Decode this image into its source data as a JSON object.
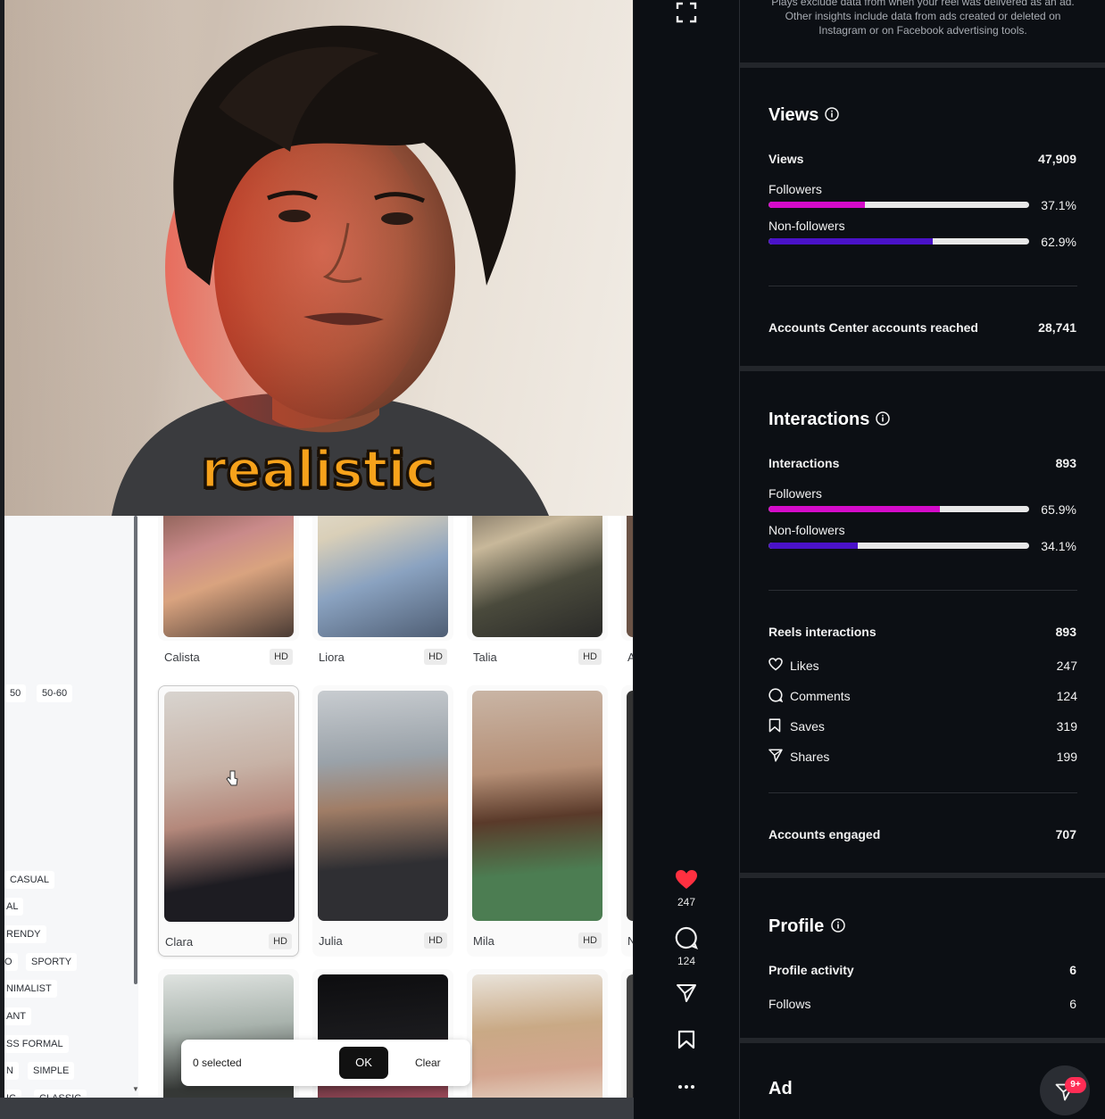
{
  "video": {
    "caption": "realistic",
    "filter_chips": [
      "50",
      "50-60",
      "CASUAL",
      "AL",
      "RENDY",
      "O",
      "SPORTY",
      "NIMALIST",
      "ANT",
      "SS FORMAL",
      "N",
      "SIMPLE",
      "IC",
      "CLASSIC"
    ],
    "cards": [
      {
        "name": "Calista",
        "badge": "HD"
      },
      {
        "name": "Liora",
        "badge": "HD"
      },
      {
        "name": "Talia",
        "badge": "HD"
      },
      {
        "name": "A"
      },
      {
        "name": "Clara",
        "badge": "HD"
      },
      {
        "name": "Julia",
        "badge": "HD"
      },
      {
        "name": "Mila",
        "badge": "HD"
      },
      {
        "name": "N"
      }
    ],
    "selection_bar": {
      "count": "0 selected",
      "ok": "OK",
      "clear": "Clear"
    }
  },
  "rail": {
    "likes": "247",
    "comments": "124",
    "icons": [
      "fullscreen-icon",
      "heart-icon",
      "comment-icon",
      "share-icon",
      "bookmark-icon",
      "more-icon"
    ]
  },
  "panel": {
    "note_lines": [
      "Plays exclude data from when your reel was delivered as an ad.",
      "Other insights include data from ads created or deleted on",
      "Instagram or on Facebook advertising tools."
    ],
    "views": {
      "title": "Views",
      "total_label": "Views",
      "total_value": "47,909",
      "followers_label": "Followers",
      "followers_pct": "37.1%",
      "followers_fraction": 0.371,
      "nonfollowers_label": "Non-followers",
      "nonfollowers_pct": "62.9%",
      "nonfollowers_fraction": 0.629,
      "reached_label": "Accounts Center accounts reached",
      "reached_value": "28,741"
    },
    "interactions": {
      "title": "Interactions",
      "total_label": "Interactions",
      "total_value": "893",
      "followers_label": "Followers",
      "followers_pct": "65.9%",
      "followers_fraction": 0.659,
      "nonfollowers_label": "Non-followers",
      "nonfollowers_pct": "34.1%",
      "nonfollowers_fraction": 0.341,
      "reels_label": "Reels interactions",
      "reels_value": "893",
      "likes_label": "Likes",
      "likes_value": "247",
      "comments_label": "Comments",
      "comments_value": "124",
      "saves_label": "Saves",
      "saves_value": "319",
      "shares_label": "Shares",
      "shares_value": "199",
      "engaged_label": "Accounts engaged",
      "engaged_value": "707"
    },
    "profile": {
      "title": "Profile",
      "activity_label": "Profile activity",
      "activity_value": "6",
      "follows_label": "Follows",
      "follows_value": "6"
    },
    "ad": {
      "title": "Ad"
    },
    "fab_badge": "9+",
    "colors": {
      "followers": "#d40bc9",
      "nonfollowers": "#4a12c8",
      "track": "#e8e8e8",
      "heart": "#ff3040"
    }
  }
}
